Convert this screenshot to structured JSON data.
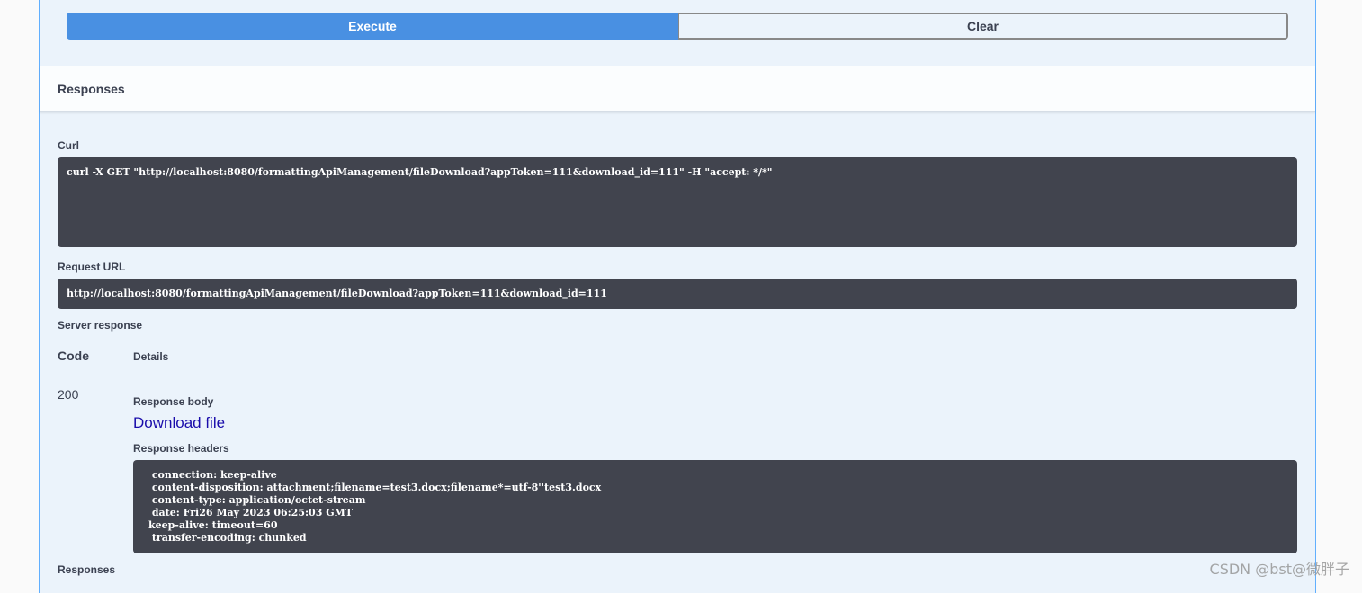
{
  "actions": {
    "execute_label": "Execute",
    "clear_label": "Clear"
  },
  "responses_section": {
    "title": "Responses"
  },
  "curl": {
    "label": "Curl",
    "command": "curl -X GET \"http://localhost:8080/formattingApiManagement/fileDownload?appToken=111&download_id=111\" -H \"accept: */*\""
  },
  "request_url": {
    "label": "Request URL",
    "value": "http://localhost:8080/formattingApiManagement/fileDownload?appToken=111&download_id=111"
  },
  "server_response": {
    "label": "Server response",
    "table_header": {
      "code": "Code",
      "details": "Details"
    },
    "row": {
      "code": "200",
      "body_label": "Response body",
      "download_link": "Download file",
      "headers_label": "Response headers",
      "headers_text": " connection: keep-alive\n content-disposition: attachment;filename=test3.docx;filename*=utf-8''test3.docx\n content-type: application/octet-stream\n date: Fri26 May 2023 06:25:03 GMT\nkeep-alive: timeout=60\n transfer-encoding: chunked"
    }
  },
  "responses_footer_label": "Responses",
  "watermark": "CSDN @bst@微胖子",
  "colors": {
    "execute": "#4990e2",
    "block_bg": "#ebf3fb",
    "code_bg": "#41444e",
    "border": "#61affe"
  }
}
